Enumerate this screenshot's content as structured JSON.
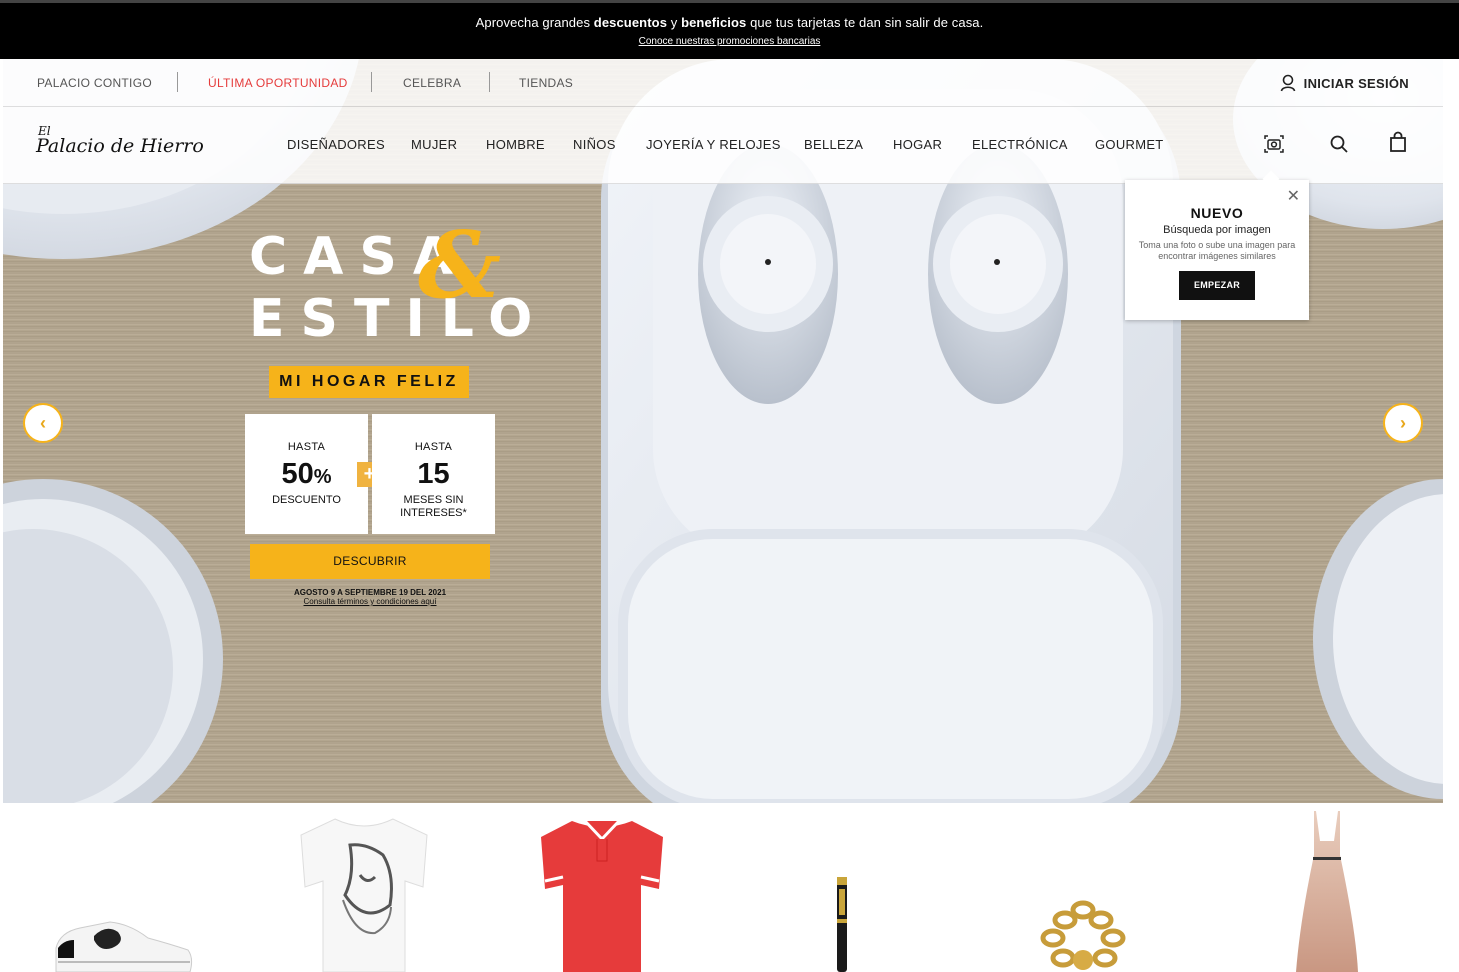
{
  "promo": {
    "text_a": "Aprovecha grandes ",
    "text_b": "descuentos",
    "text_c": " y ",
    "text_d": "beneficios",
    "text_e": " que tus tarjetas te dan sin salir de casa.",
    "link": "Conoce nuestras promociones bancarias"
  },
  "util_nav": {
    "items": [
      "PALACIO CONTIGO",
      "ÚLTIMA OPORTUNIDAD",
      "CELEBRA",
      "TIENDAS"
    ],
    "highlight_color": "#e53c3c",
    "login": "INICIAR SESIÓN"
  },
  "brand": {
    "logo_line1": "El",
    "logo_line2": "Palacio de Hierro"
  },
  "main_nav": [
    "DISEÑADORES",
    "MUJER",
    "HOMBRE",
    "NIÑOS",
    "JOYERÍA Y RELOJES",
    "BELLEZA",
    "HOGAR",
    "ELECTRÓNICA",
    "GOURMET"
  ],
  "icons": [
    "camera-search-icon",
    "search-icon",
    "shopping-bag-icon",
    "user-icon",
    "close-icon",
    "chevron-left-icon",
    "chevron-right-icon"
  ],
  "image_search_popup": {
    "title": "NUEVO",
    "subtitle": "Búsqueda por imagen",
    "description": "Toma una foto o sube una imagen para encontrar imágenes similares",
    "button": "EMPEZAR"
  },
  "hero": {
    "title_line1": "CASA",
    "ampersand": "&",
    "title_line2": "ESTILO",
    "tagline": "MI HOGAR FELIZ",
    "offer1": {
      "top": "HASTA",
      "value": "50",
      "unit": "%",
      "bottom": "DESCUENTO"
    },
    "plus": "+",
    "offer2": {
      "top": "HASTA",
      "value": "15",
      "bottom": "MESES SIN INTERESES*"
    },
    "cta": "DESCUBRIR",
    "dates": "AGOSTO 9 A SEPTIEMBRE 19 DEL 2021",
    "terms": "Consulta términos y condiciones aquí"
  },
  "colors": {
    "accent": "#f6b31a",
    "dark": "#000000",
    "sale_red": "#e53c3c"
  },
  "carousel": {
    "prev": "‹",
    "next": "›"
  },
  "products": [
    "sneaker",
    "printed-tshirt",
    "red-polo",
    "fountain-pen",
    "gold-chain-bracelet",
    "slip-dress"
  ]
}
